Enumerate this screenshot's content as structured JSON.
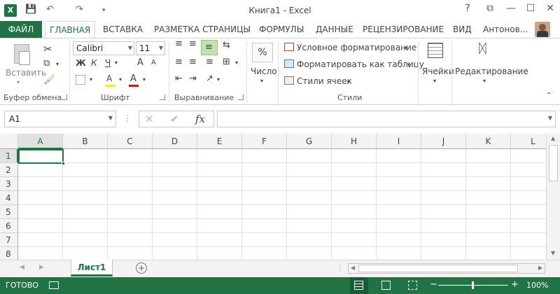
{
  "title_bar": {
    "app_badge": "X",
    "title": "Книга1 - Excel",
    "help": "?",
    "qat": {
      "save": "💾",
      "undo": "↶",
      "redo": "↷",
      "customize": "▾"
    },
    "window_buttons": {
      "ribbon_options": "⧉",
      "minimize": "—",
      "restore": "☐",
      "close": "✕"
    }
  },
  "tabs": {
    "file": "ФАЙЛ",
    "home": "ГЛАВНАЯ",
    "insert": "ВСТАВКА",
    "layout": "РАЗМЕТКА СТРАНИЦЫ",
    "formulas": "ФОРМУЛЫ",
    "data": "ДАННЫЕ",
    "review": "РЕЦЕНЗИРОВАНИЕ",
    "view": "ВИД",
    "user": "Антонов..."
  },
  "ribbon": {
    "clipboard": {
      "label": "Буфер обмена",
      "paste": "Вставить"
    },
    "font": {
      "label": "Шрифт",
      "font_name": "Calibri",
      "font_size": "11",
      "bold": "Ж",
      "italic": "К",
      "underline": "Ч",
      "grow": "A",
      "shrink": "A",
      "fill": "A",
      "fontcolor": "A"
    },
    "alignment": {
      "label": "Выравнивание"
    },
    "number": {
      "label": "Число",
      "percent": "%"
    },
    "styles": {
      "label": "Стили",
      "conditional": "Условное форматирование",
      "as_table": "Форматировать как таблицу",
      "cell_styles": "Стили ячеек"
    },
    "cells": {
      "label": "Ячейки"
    },
    "editing": {
      "label": "Редактирование"
    }
  },
  "formula_bar": {
    "name_box": "A1",
    "formula": "",
    "fx": "fx",
    "cancel": "✕",
    "enter": "✔"
  },
  "columns": [
    "A",
    "B",
    "C",
    "D",
    "E",
    "F",
    "G",
    "H",
    "I",
    "J",
    "K",
    "L"
  ],
  "rows": [
    "1",
    "2",
    "3",
    "4",
    "5",
    "6",
    "7",
    "8"
  ],
  "sheets": {
    "active": "Лист1",
    "add": "+"
  },
  "status": {
    "ready": "ГОТОВО",
    "zoom": "100%",
    "zoom_minus": "−",
    "zoom_plus": "+"
  },
  "colors": {
    "accent": "#217346",
    "header_bg": "#f3f3f3",
    "grid_line": "#e1e1e1"
  }
}
